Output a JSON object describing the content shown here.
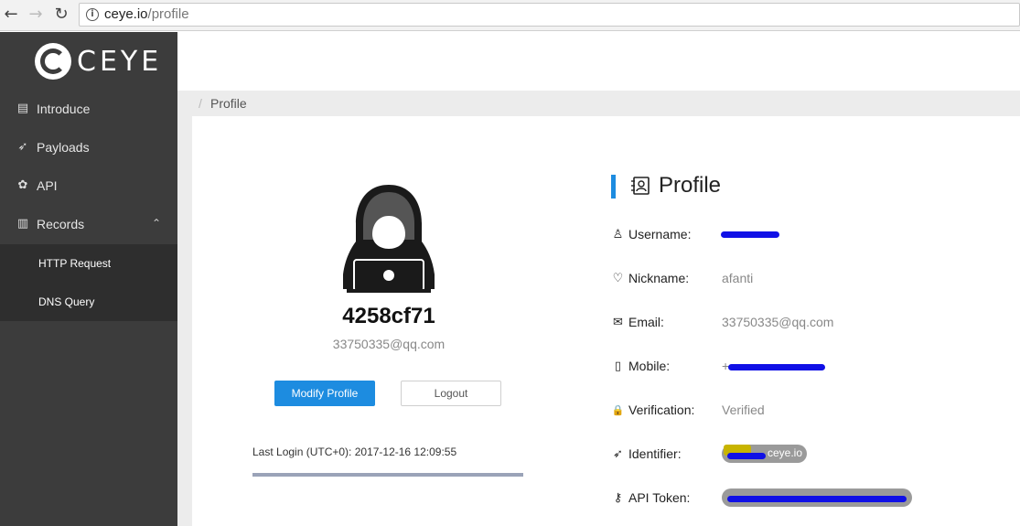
{
  "browser": {
    "url_host": "ceye.io",
    "url_path": "/profile",
    "back_icon": "←",
    "forward_icon": "→",
    "reload_icon": "↻",
    "info_icon": "i"
  },
  "sidebar": {
    "logo_text": "CEYE",
    "items": [
      {
        "label": "Introduce",
        "icon": "book-icon",
        "glyph": "▤"
      },
      {
        "label": "Payloads",
        "icon": "rocket-icon",
        "glyph": "➶"
      },
      {
        "label": "API",
        "icon": "molecule-icon",
        "glyph": "✿"
      },
      {
        "label": "Records",
        "icon": "document-icon",
        "glyph": "▥",
        "chevron": "⌃"
      }
    ],
    "submenu": [
      {
        "label": "HTTP Request"
      },
      {
        "label": "DNS Query"
      }
    ]
  },
  "breadcrumb": {
    "separator": "/",
    "current": "Profile"
  },
  "profile_card": {
    "user_id": "4258cf71",
    "email": "33750335@qq.com",
    "modify_label": "Modify Profile",
    "logout_label": "Logout",
    "last_login": "Last Login (UTC+0): 2017-12-16 12:09:55"
  },
  "details": {
    "title": "Profile",
    "rows": [
      {
        "label": "Username:",
        "value": "",
        "icon": "user-icon",
        "glyph": "♙"
      },
      {
        "label": "Nickname:",
        "value": "afanti",
        "icon": "heart-icon",
        "glyph": "♡"
      },
      {
        "label": "Email:",
        "value": "33750335@qq.com",
        "icon": "mail-icon",
        "glyph": "✉"
      },
      {
        "label": "Mobile:",
        "value": "+",
        "icon": "phone-icon",
        "glyph": "▯"
      },
      {
        "label": "Verification:",
        "value": "Verified",
        "icon": "lock-icon",
        "glyph": "🔒"
      },
      {
        "label": "Identifier:",
        "value": "ceye.io",
        "icon": "rocket-icon",
        "glyph": "➶"
      },
      {
        "label": "API Token:",
        "value": "",
        "icon": "key-icon",
        "glyph": "⚷"
      }
    ]
  },
  "colors": {
    "accent": "#1d8ce0",
    "sidebar_bg": "#3c3c3c",
    "submenu_bg": "#2e2e2e",
    "redaction": "#1010e6"
  }
}
